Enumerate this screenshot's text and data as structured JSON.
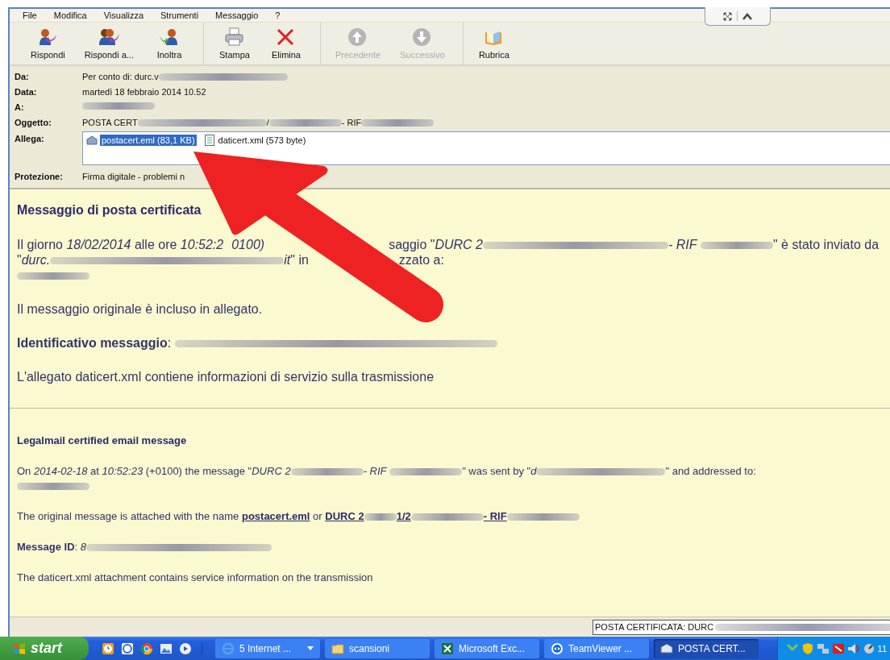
{
  "menu": [
    "File",
    "Modifica",
    "Visualizza",
    "Strumenti",
    "Messaggio",
    "?"
  ],
  "toolbar": [
    [
      {
        "label": "Rispondi",
        "kind": "reply",
        "disabled": false
      },
      {
        "label": "Rispondi a...",
        "kind": "reply-all",
        "disabled": false
      },
      {
        "label": "Inoltra",
        "kind": "forward",
        "disabled": false
      }
    ],
    [
      {
        "label": "Stampa",
        "kind": "print",
        "disabled": false
      },
      {
        "label": "Elimina",
        "kind": "delete",
        "disabled": false
      }
    ],
    [
      {
        "label": "Precedente",
        "kind": "up",
        "disabled": true
      },
      {
        "label": "Successivo",
        "kind": "down",
        "disabled": true
      }
    ],
    [
      {
        "label": "Rubrica",
        "kind": "book",
        "disabled": false
      }
    ]
  ],
  "headers": [
    {
      "label": "Da:",
      "kind": "text",
      "parts": [
        {
          "kind": "text",
          "text": "Per conto di: durc.v"
        },
        {
          "kind": "blur"
        }
      ]
    },
    {
      "label": "Data:",
      "kind": "text",
      "parts": [
        {
          "kind": "text",
          "text": "martedì 18 febbraio 2014 10.52"
        }
      ]
    },
    {
      "label": "A:",
      "kind": "text",
      "parts": [
        {
          "kind": "blur"
        }
      ]
    },
    {
      "label": "Oggetto:",
      "kind": "text",
      "parts": [
        {
          "kind": "text",
          "text": "POSTA CERT"
        },
        {
          "kind": "blur"
        },
        {
          "kind": "text",
          "text": "/"
        },
        {
          "kind": "blur"
        },
        {
          "kind": "text",
          "text": " - RIF"
        },
        {
          "kind": "blur"
        }
      ]
    },
    {
      "label": "Allega:",
      "kind": "attachments",
      "attachments": [
        {
          "name": "postacert.eml (83,1 KB)",
          "kind": "email",
          "selected": true
        },
        {
          "name": "daticert.xml (573 byte)",
          "kind": "xml",
          "selected": false
        }
      ]
    },
    {
      "label": "Protezione:",
      "kind": "text",
      "parts": [
        {
          "kind": "text",
          "text": "Firma digitale - problemi n"
        }
      ]
    }
  ],
  "body": [
    {
      "kind": "heading",
      "parts": [
        {
          "kind": "text",
          "text": "Messaggio di posta certificata"
        }
      ]
    },
    {
      "kind": "para",
      "parts": [
        {
          "kind": "text",
          "text": "Il giorno *18/02/2014* alle ore *10:52:2*"
        },
        {
          "kind": "covered"
        },
        {
          "kind": "text",
          "text": "*0100)*"
        },
        {
          "kind": "covered"
        },
        {
          "kind": "text",
          "text": "saggio \"*DURC 2*"
        },
        {
          "kind": "blur"
        },
        {
          "kind": "text",
          "text": "*- RIF* "
        },
        {
          "kind": "blur"
        },
        {
          "kind": "text",
          "text": "\" è stato inviato da"
        },
        {
          "kind": "br"
        },
        {
          "kind": "text",
          "text": "\"*durc.*"
        },
        {
          "kind": "blur"
        },
        {
          "kind": "text",
          "text": "*it*\" in"
        },
        {
          "kind": "covered"
        },
        {
          "kind": "text",
          "text": "zzato a:"
        },
        {
          "kind": "br"
        },
        {
          "kind": "blur"
        }
      ]
    },
    {
      "kind": "para",
      "parts": [
        {
          "kind": "text",
          "text": "Il messaggio originale è incluso in allegato."
        }
      ]
    },
    {
      "kind": "para",
      "parts": [
        {
          "kind": "text",
          "text": "**Identificativo messaggio**: "
        },
        {
          "kind": "blur"
        }
      ]
    },
    {
      "kind": "para",
      "parts": [
        {
          "kind": "text",
          "text": "L'allegato daticert.xml contiene informazioni di servizio sulla trasmissione"
        }
      ]
    },
    {
      "kind": "rule"
    },
    {
      "kind": "subheading",
      "parts": [
        {
          "kind": "text",
          "text": "Legalmail certified email message"
        }
      ]
    },
    {
      "kind": "small",
      "parts": [
        {
          "kind": "text",
          "text": "On *2014-02-18* at *10:52:23* (+0100) the message \"*DURC 2*"
        },
        {
          "kind": "blur"
        },
        {
          "kind": "text",
          "text": "*- RIF* "
        },
        {
          "kind": "blur"
        },
        {
          "kind": "text",
          "text": "\" was sent by \"*d*"
        },
        {
          "kind": "blur"
        },
        {
          "kind": "text",
          "text": "\" and addressed to:"
        },
        {
          "kind": "br"
        },
        {
          "kind": "blur"
        }
      ]
    },
    {
      "kind": "small",
      "parts": [
        {
          "kind": "text",
          "text": "The original message is attached with the name "
        },
        {
          "kind": "link",
          "text": "postacert.eml"
        },
        {
          "kind": "text",
          "text": " or "
        },
        {
          "kind": "link",
          "text": "DURC 2"
        },
        {
          "kind": "blur"
        },
        {
          "kind": "link",
          "text": "1/2"
        },
        {
          "kind": "blur"
        },
        {
          "kind": "link",
          "text": "- RIF"
        },
        {
          "kind": "blur"
        }
      ]
    },
    {
      "kind": "small",
      "parts": [
        {
          "kind": "text",
          "text": "**Message ID**: *8*"
        },
        {
          "kind": "blur"
        }
      ]
    },
    {
      "kind": "small",
      "parts": [
        {
          "kind": "text",
          "text": "The daticert.xml attachment contains service information on the transmission"
        }
      ]
    }
  ],
  "status_bar": {
    "parts": [
      {
        "kind": "text",
        "text": "POSTA CERTIFICATA: DURC"
      },
      {
        "kind": "blur"
      }
    ]
  },
  "taskbar": {
    "start": "start",
    "tasks": [
      {
        "label": "5 Internet ...",
        "kind": "browser",
        "dropdown": true,
        "selected": false
      },
      {
        "label": "scansioni",
        "kind": "folder",
        "dropdown": false,
        "selected": false
      },
      {
        "label": "Microsoft Exc...",
        "kind": "sheet",
        "dropdown": false,
        "selected": false
      },
      {
        "label": "TeamViewer ...",
        "kind": "remote",
        "dropdown": false,
        "selected": false
      },
      {
        "label": "POSTA CERT...",
        "kind": "mail",
        "dropdown": false,
        "selected": true
      }
    ],
    "clock": "11"
  }
}
